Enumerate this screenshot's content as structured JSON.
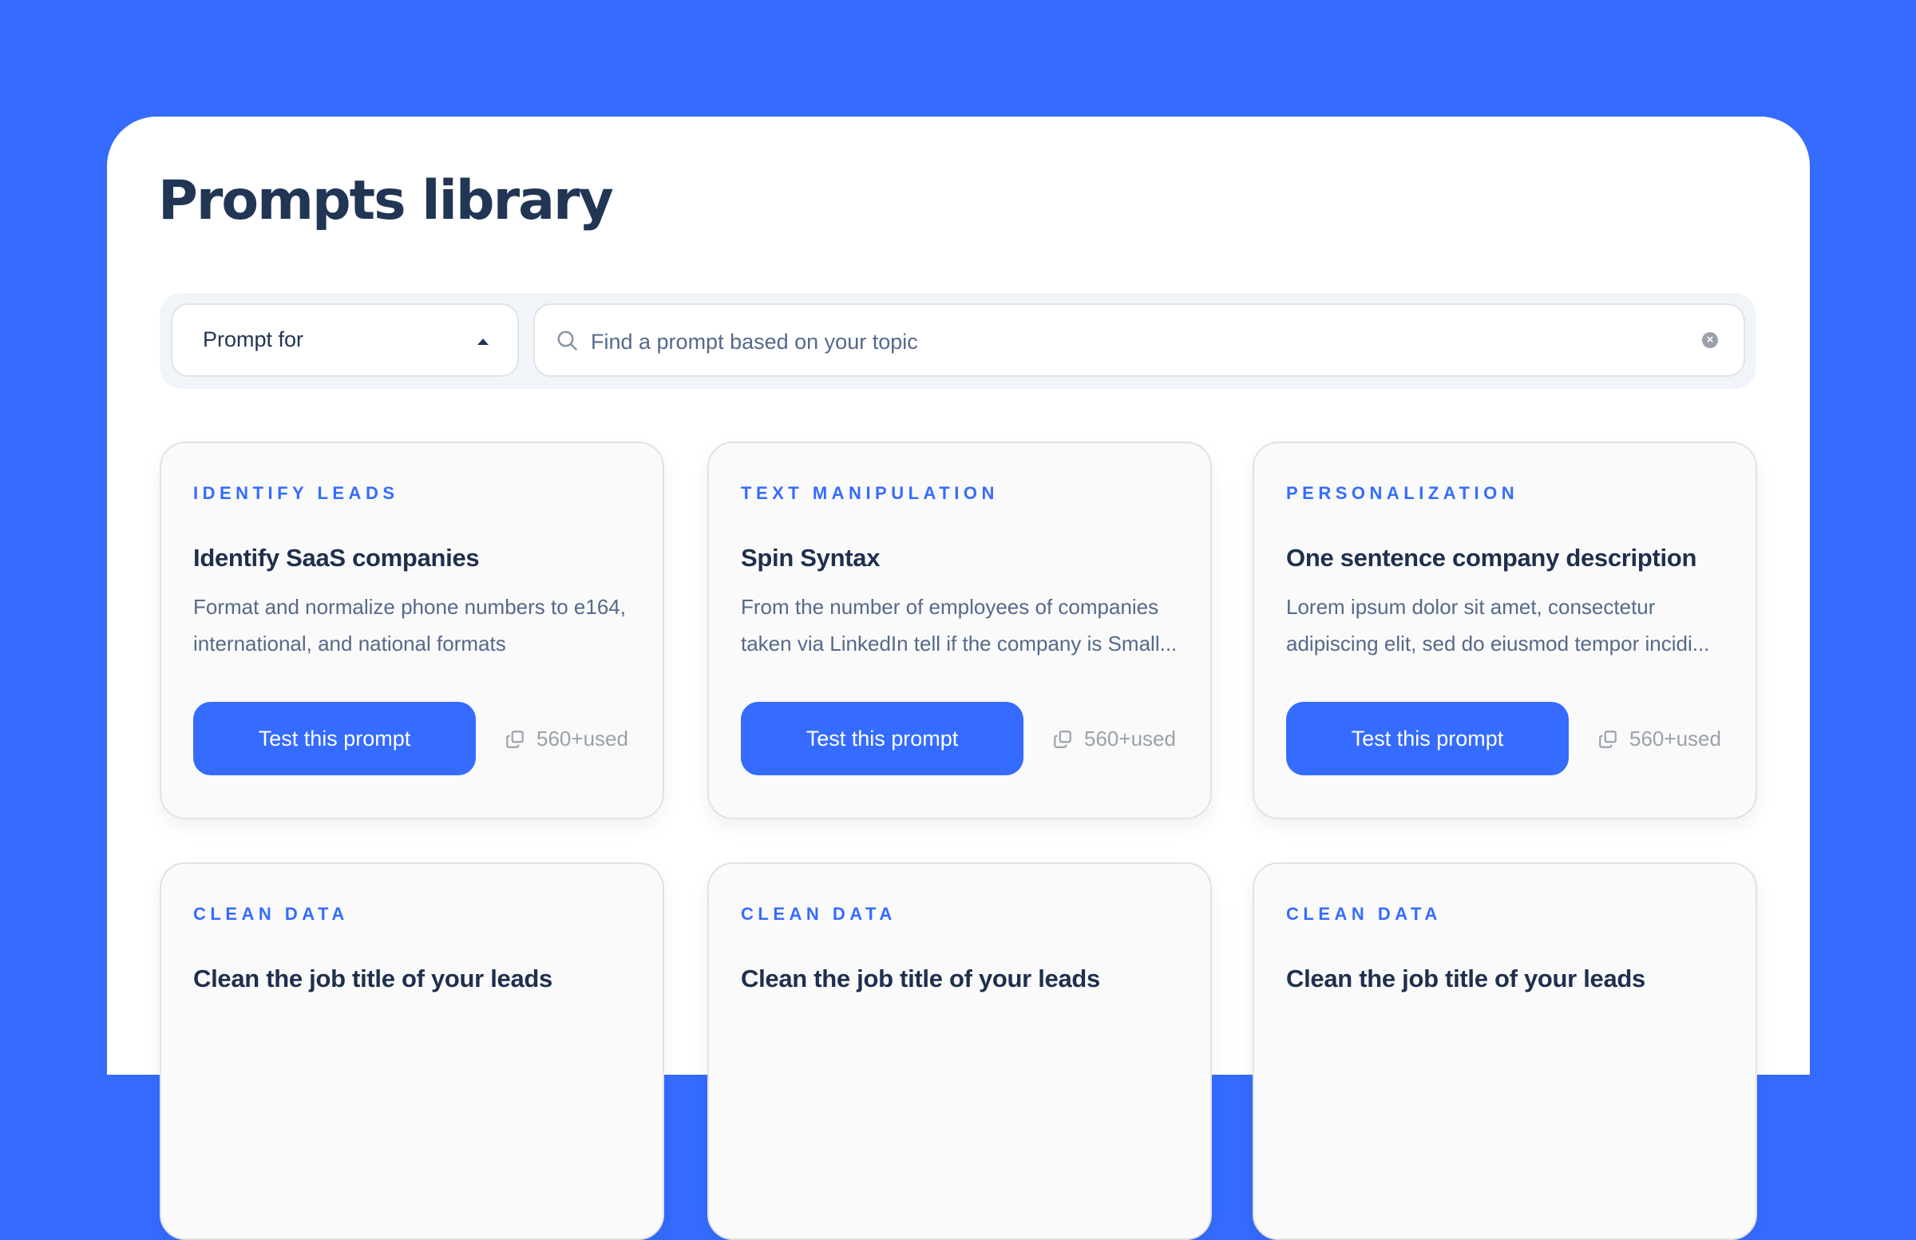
{
  "page": {
    "title": "Prompts library"
  },
  "filters": {
    "dropdown_label": "Prompt for",
    "search_placeholder": "Find a prompt based on your topic",
    "search_value": ""
  },
  "colors": {
    "brand": "#356cff",
    "title": "#213554",
    "muted": "#56698a"
  },
  "cards": [
    {
      "category": "IDENTIFY LEADS",
      "title": "Identify SaaS companies",
      "description": "Format and normalize phone numbers to e164, international, and national formats",
      "button": "Test this prompt",
      "usage": "560+used"
    },
    {
      "category": "TEXT MANIPULATION",
      "title": "Spin Syntax",
      "description": "From the number of employees of companies taken via LinkedIn tell if the company is Small...",
      "button": "Test this prompt",
      "usage": "560+used"
    },
    {
      "category": "PERSONALIZATION",
      "title": "One sentence company description",
      "description": "Lorem ipsum dolor sit amet, consectetur adipiscing elit, sed do eiusmod tempor incidi...",
      "button": "Test this prompt",
      "usage": "560+used"
    },
    {
      "category": "CLEAN DATA",
      "title": "Clean the job title of your leads",
      "description": "",
      "button": "",
      "usage": ""
    },
    {
      "category": "CLEAN DATA",
      "title": "Clean the job title of your leads",
      "description": "",
      "button": "",
      "usage": ""
    },
    {
      "category": "CLEAN DATA",
      "title": "Clean the job title of your leads",
      "description": "",
      "button": "",
      "usage": ""
    }
  ]
}
